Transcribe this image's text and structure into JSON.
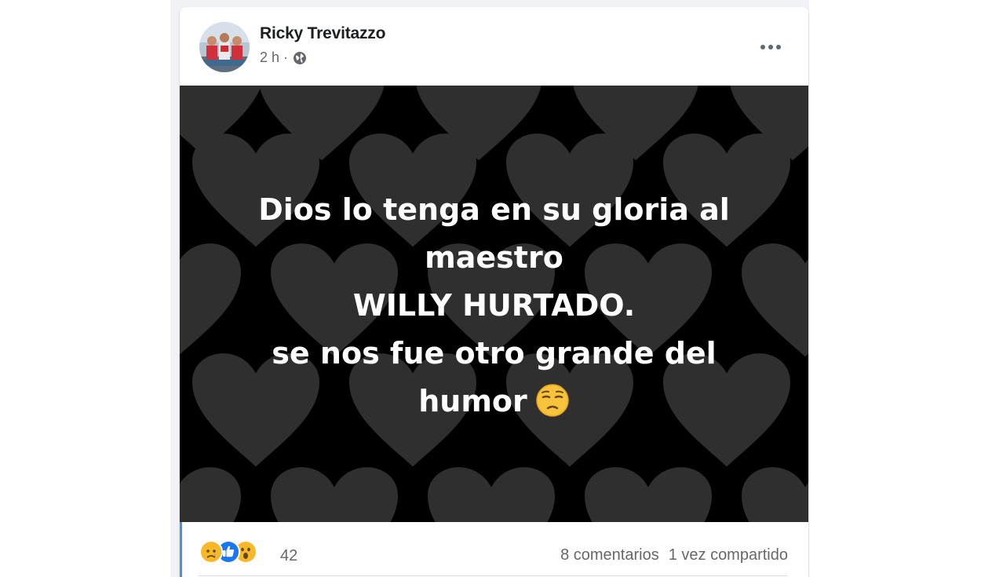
{
  "post": {
    "author": "Ricky Trevitazzo",
    "timestamp": "2 h",
    "separator": "·",
    "privacy_icon": "globe-icon",
    "more_icon": "more-horizontal-icon",
    "image_text": {
      "line1": "Dios lo tenga en su gloria al",
      "line2": "maestro",
      "line3": "WILLY HURTADO.",
      "line4": "se nos fue otro grande del",
      "line5": "humor",
      "emoji": "pensive-face-emoji"
    },
    "image_background": "heart-pattern"
  },
  "reactions": {
    "icons": [
      "sad-reaction-icon",
      "like-reaction-icon",
      "wow-reaction-icon"
    ],
    "count": "42",
    "comments": "8 comentarios",
    "shares": "1 vez compartido"
  },
  "colors": {
    "text_primary": "#1c1e21",
    "text_secondary": "#65676b",
    "like_blue": "#1877f2",
    "image_bg": "#000000",
    "heart_gray": "#2f2f2f"
  }
}
